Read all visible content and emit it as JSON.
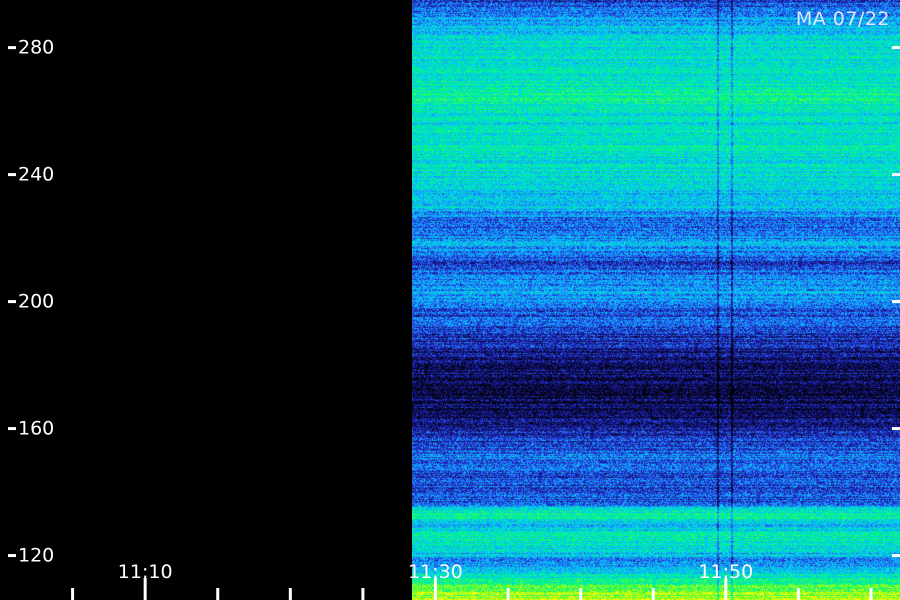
{
  "station_label": "MA 07/22",
  "chart_data": {
    "type": "heatmap",
    "title": "",
    "xlabel": "",
    "ylabel": "",
    "x_tick_labels": [
      "11:10",
      "11:30",
      "11:50"
    ],
    "x_major_ticks": [
      "11:05",
      "11:10",
      "11:15",
      "11:20",
      "11:25",
      "11:30",
      "11:35",
      "11:40",
      "11:45",
      "11:50",
      "11:55",
      "12:00"
    ],
    "x_range": [
      "11:00",
      "12:02"
    ],
    "data_start": "11:29",
    "y_tick_labels": [
      120,
      160,
      200,
      240,
      280
    ],
    "ylim": [
      106,
      295
    ],
    "colormap": [
      "#000000",
      "#101060",
      "#2020c0",
      "#2878ff",
      "#00c8ff",
      "#00e6c0",
      "#00ff66",
      "#80ff20",
      "#ffff00"
    ],
    "background_color": "#000000",
    "intensity_by_value": [
      {
        "y": 106,
        "level": 0.95
      },
      {
        "y": 110,
        "level": 0.8
      },
      {
        "y": 118,
        "level": 0.4
      },
      {
        "y": 122,
        "level": 0.55
      },
      {
        "y": 126,
        "level": 0.65
      },
      {
        "y": 130,
        "level": 0.5
      },
      {
        "y": 133,
        "level": 0.7
      },
      {
        "y": 137,
        "level": 0.35
      },
      {
        "y": 145,
        "level": 0.3
      },
      {
        "y": 152,
        "level": 0.38
      },
      {
        "y": 158,
        "level": 0.22
      },
      {
        "y": 165,
        "level": 0.12
      },
      {
        "y": 172,
        "level": 0.1
      },
      {
        "y": 178,
        "level": 0.14
      },
      {
        "y": 185,
        "level": 0.2
      },
      {
        "y": 192,
        "level": 0.3
      },
      {
        "y": 198,
        "level": 0.35
      },
      {
        "y": 203,
        "level": 0.45
      },
      {
        "y": 208,
        "level": 0.4
      },
      {
        "y": 213,
        "level": 0.28
      },
      {
        "y": 218,
        "level": 0.48
      },
      {
        "y": 224,
        "level": 0.3
      },
      {
        "y": 230,
        "level": 0.5
      },
      {
        "y": 236,
        "level": 0.55
      },
      {
        "y": 242,
        "level": 0.6
      },
      {
        "y": 250,
        "level": 0.62
      },
      {
        "y": 258,
        "level": 0.58
      },
      {
        "y": 264,
        "level": 0.68
      },
      {
        "y": 270,
        "level": 0.6
      },
      {
        "y": 276,
        "level": 0.62
      },
      {
        "y": 283,
        "level": 0.56
      },
      {
        "y": 290,
        "level": 0.42
      },
      {
        "y": 295,
        "level": 0.25
      }
    ],
    "dark_time_lines": [
      "11:50",
      "11:51"
    ],
    "grid": false
  }
}
